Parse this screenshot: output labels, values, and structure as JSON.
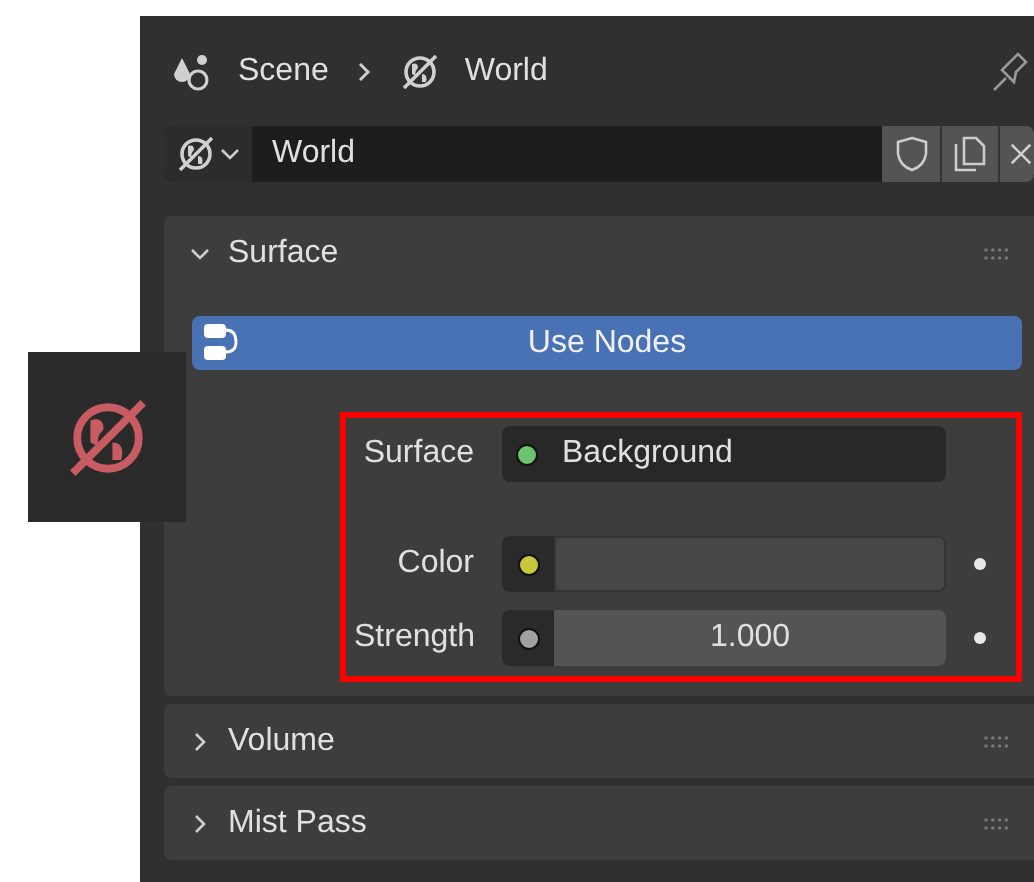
{
  "breadcrumb": [
    {
      "kind": "scene",
      "label": "Scene"
    },
    {
      "kind": "world",
      "label": "World"
    }
  ],
  "datablock": {
    "name": "World"
  },
  "sections": [
    {
      "title": "Surface",
      "expanded": true
    },
    {
      "title": "Volume",
      "expanded": false
    },
    {
      "title": "Mist Pass",
      "expanded": false
    }
  ],
  "use_nodes": {
    "label": "Use Nodes"
  },
  "properties": [
    {
      "kind": "dropdown",
      "label": "Surface",
      "value": "Background",
      "color": "#6cc46c"
    },
    {
      "kind": "color",
      "label": "Color",
      "color": "#c8c83a"
    },
    {
      "kind": "number",
      "label": "Strength",
      "value": "1.000",
      "color": "#a0a0a0"
    }
  ]
}
